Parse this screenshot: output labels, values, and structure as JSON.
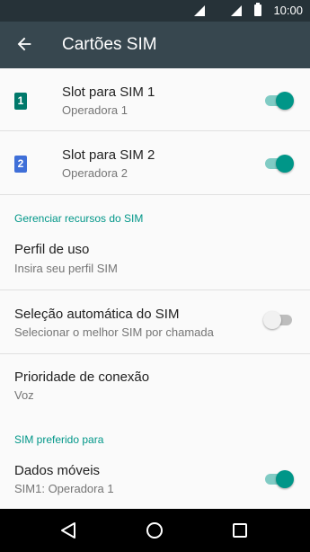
{
  "status_bar": {
    "time": "10:00"
  },
  "app_bar": {
    "title": "Cartões SIM",
    "back_icon": "arrow-back-icon"
  },
  "sim_slots": [
    {
      "badge": "1",
      "color": "#00796b",
      "title": "Slot para SIM 1",
      "subtitle": "Operadora 1",
      "enabled": true
    },
    {
      "badge": "2",
      "color": "#3f6fd8",
      "title": "Slot para SIM 2",
      "subtitle": "Operadora 2",
      "enabled": true
    }
  ],
  "manage_section": {
    "header": "Gerenciar recursos do SIM",
    "items": [
      {
        "title": "Perfil de uso",
        "subtitle": "Insira seu perfil SIM"
      },
      {
        "title": "Seleção automática do SIM",
        "subtitle": "Selecionar o melhor SIM por chamada",
        "enabled": false
      },
      {
        "title": "Prioridade de conexão",
        "subtitle": "Voz"
      }
    ]
  },
  "preferred_section": {
    "header": "SIM preferido para",
    "items": [
      {
        "title": "Dados móveis",
        "subtitle": "SIM1: Operadora 1",
        "enabled": true
      }
    ]
  },
  "accent_color": "#009688",
  "nav_bar": {
    "icons": [
      "back-triangle-icon",
      "home-circle-icon",
      "recents-square-icon"
    ]
  }
}
